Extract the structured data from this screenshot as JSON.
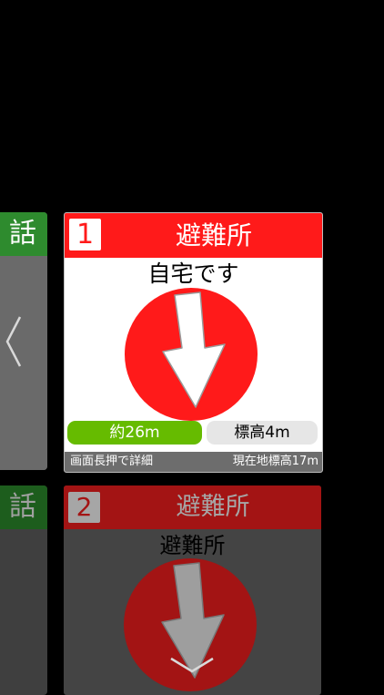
{
  "cards": {
    "current": {
      "number": "1",
      "title": "避難所",
      "destination": "自宅です",
      "distance": "約26m",
      "elevation": "標高4m",
      "footer_hint": "画面長押で詳細",
      "footer_current_elevation": "現在地標高17m"
    },
    "next": {
      "number": "2",
      "title": "避難所",
      "destination": "避難所"
    },
    "side_label": "話"
  },
  "icons": {
    "prev": "chevron-left-icon",
    "next": "chevron-down-icon",
    "direction": "arrow-down-icon"
  },
  "colors": {
    "header_red": "#ff1a1a",
    "distance_green": "#66bb00"
  }
}
